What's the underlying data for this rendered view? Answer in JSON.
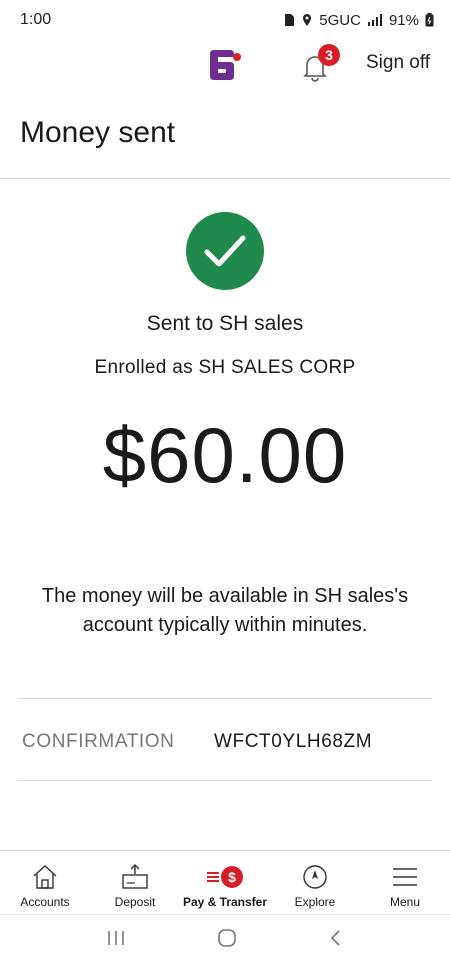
{
  "status_bar": {
    "time": "1:00",
    "network": "5GUC",
    "battery": "91%"
  },
  "header": {
    "sign_off_label": "Sign off",
    "notification_count": "3",
    "brand_color": "#6e2e91",
    "badge_color": "#d71e28"
  },
  "page": {
    "title": "Money sent"
  },
  "confirmation": {
    "sent_to": "Sent to SH sales",
    "enrolled_as": "Enrolled as SH SALES CORP",
    "amount": "$60.00",
    "availability_message": "The money will be available in SH sales's account typically within minutes.",
    "confirmation_label": "CONFIRMATION",
    "confirmation_number": "WFCT0YLH68ZM",
    "success_color": "#1f8a4c"
  },
  "bottom_nav": {
    "items": [
      {
        "label": "Accounts",
        "icon": "home-icon"
      },
      {
        "label": "Deposit",
        "icon": "deposit-icon"
      },
      {
        "label": "Pay & Transfer",
        "icon": "pay-transfer-icon",
        "active": true
      },
      {
        "label": "Explore",
        "icon": "compass-icon"
      },
      {
        "label": "Menu",
        "icon": "menu-icon"
      }
    ],
    "pay_symbol": "$"
  }
}
